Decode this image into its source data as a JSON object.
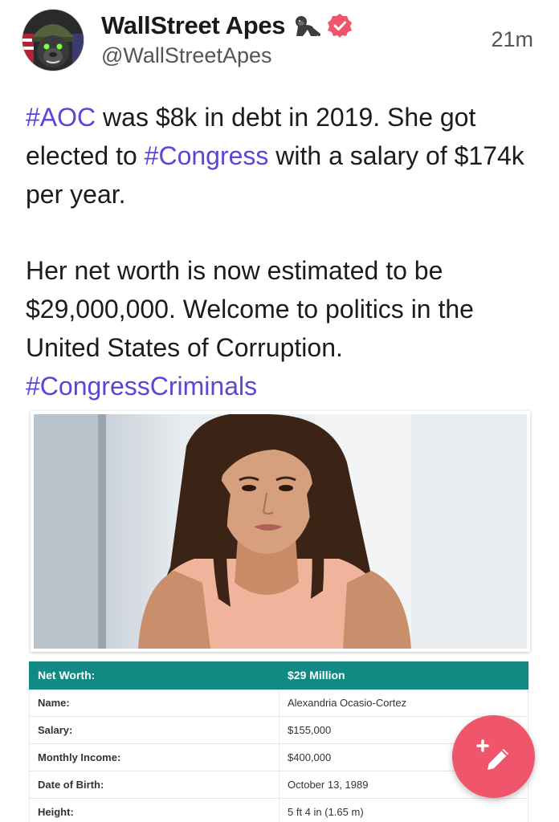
{
  "author": {
    "display_name": "WallStreet Apes",
    "handle": "@WallStreetApes",
    "timestamp": "21m",
    "avatar_icon": "gorilla-soldier-avatar",
    "name_emoji_icon": "gorilla-emoji-icon",
    "verified_icon": "verified-badge-icon"
  },
  "post": {
    "p1_tag1": "#AOC",
    "p1_text1": " was $8k in debt in 2019. She got elected to ",
    "p1_tag2": "#Congress",
    "p1_text2": " with a salary of $174k per year.",
    "p2_text": "Her net worth is now estimated to be $29,000,000. Welcome to politics in the United States of Corruption.",
    "p2_tag": "#CongressCriminals"
  },
  "info_table": {
    "header": {
      "label": "Net Worth:",
      "value": "$29 Million"
    },
    "rows": [
      {
        "label": "Name:",
        "value": "Alexandria Ocasio-Cortez"
      },
      {
        "label": "Salary:",
        "value": "$155,000"
      },
      {
        "label": "Monthly Income:",
        "value": "$400,000"
      },
      {
        "label": "Date of Birth:",
        "value": "October 13, 1989"
      },
      {
        "label": "Height:",
        "value": "5 ft 4 in (1.65 m)"
      }
    ]
  },
  "fab": {
    "icon": "pencil-compose-icon"
  },
  "colors": {
    "hashtag": "#5b46d6",
    "table_header": "#128a84",
    "fab": "#f0566b",
    "verified": "#f0566b"
  }
}
